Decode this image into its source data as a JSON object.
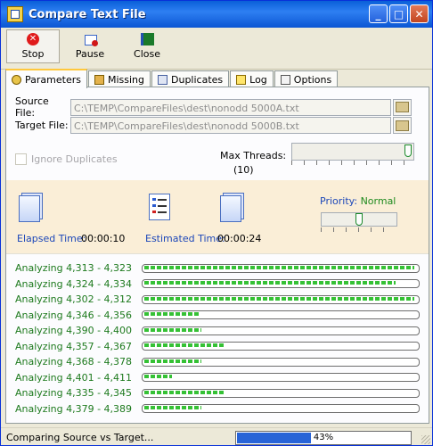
{
  "window": {
    "title": "Compare Text File"
  },
  "toolbar": {
    "stop_label": "Stop",
    "pause_label": "Pause",
    "close_label": "Close"
  },
  "tabs": [
    {
      "label": "Parameters",
      "icon": "gear-icon"
    },
    {
      "label": "Missing",
      "icon": "missing-icon"
    },
    {
      "label": "Duplicates",
      "icon": "duplicates-icon"
    },
    {
      "label": "Log",
      "icon": "log-icon"
    },
    {
      "label": "Options",
      "icon": "options-icon"
    }
  ],
  "params": {
    "source_label": "Source File:",
    "source_value": "C:\\TEMP\\CompareFiles\\dest\\nonodd 5000A.txt",
    "target_label": "Target File:",
    "target_value": "C:\\TEMP\\CompareFiles\\dest\\nonodd 5000B.txt",
    "ignore_duplicates_label": "Ignore Duplicates",
    "ignore_duplicates_checked": false,
    "max_threads_label": "Max Threads:",
    "max_threads_value": "(10)",
    "max_threads_level": 1.0
  },
  "stats": {
    "elapsed_label": "Elapsed Time:",
    "elapsed_value": "00:00:10",
    "estimated_label": "Estimated Time:",
    "estimated_value": "00:00:24",
    "priority_label": "Priority:",
    "priority_value": "Normal",
    "priority_level": 0.5
  },
  "analyzing": [
    {
      "label": "Analyzing 4,313 - 4,323",
      "progress": 0.99
    },
    {
      "label": "Analyzing 4,324 - 4,334",
      "progress": 0.92
    },
    {
      "label": "Analyzing 4,302 - 4,312",
      "progress": 0.99
    },
    {
      "label": "Analyzing 4,346 - 4,356",
      "progress": 0.2
    },
    {
      "label": "Analyzing 4,390 - 4,400",
      "progress": 0.21
    },
    {
      "label": "Analyzing 4,357 - 4,367",
      "progress": 0.29
    },
    {
      "label": "Analyzing 4,368 - 4,378",
      "progress": 0.21
    },
    {
      "label": "Analyzing 4,401 - 4,411",
      "progress": 0.1
    },
    {
      "label": "Analyzing 4,335 - 4,345",
      "progress": 0.29
    },
    {
      "label": "Analyzing 4,379 - 4,389",
      "progress": 0.21
    }
  ],
  "status": {
    "text": "Comparing Source vs Target...",
    "progress_text": "43%",
    "progress": 0.43
  },
  "colors": {
    "accent_green": "#35c135",
    "title_blue": "#0a5fd8",
    "status_blue": "#2864d7"
  }
}
